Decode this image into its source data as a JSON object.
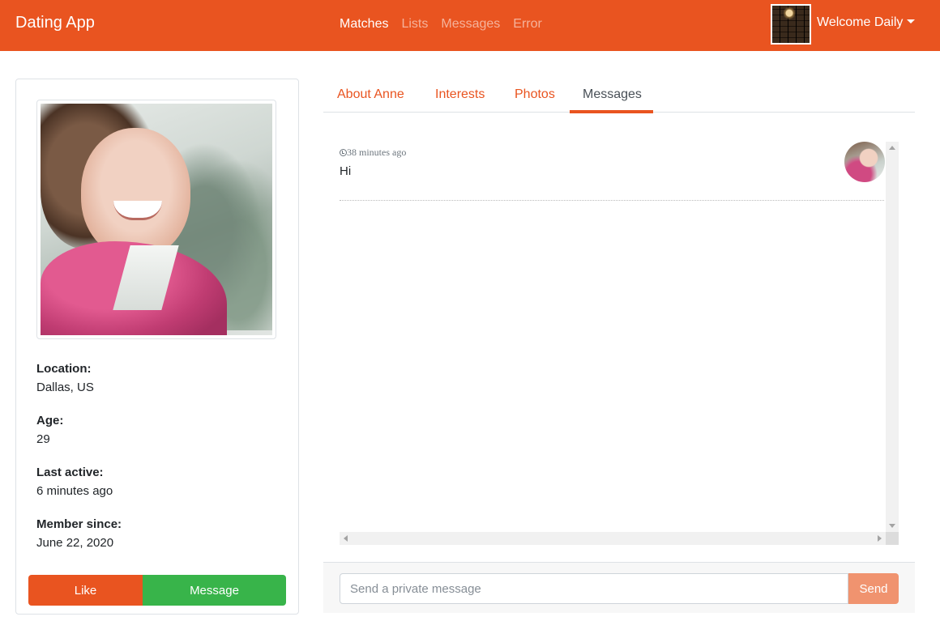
{
  "navbar": {
    "brand": "Dating App",
    "links": [
      {
        "label": "Matches",
        "active": true
      },
      {
        "label": "Lists",
        "active": false
      },
      {
        "label": "Messages",
        "active": false
      },
      {
        "label": "Error",
        "active": false
      }
    ],
    "welcome": "Welcome Daily",
    "color": "#e95420"
  },
  "profile": {
    "location_label": "Location:",
    "location": "Dallas, US",
    "age_label": "Age:",
    "age": "29",
    "last_active_label": "Last active:",
    "last_active": "6 minutes ago",
    "member_since_label": "Member since:",
    "member_since": "June 22, 2020",
    "like_label": "Like",
    "message_label": "Message"
  },
  "tabs": [
    {
      "label": "About Anne",
      "active": false
    },
    {
      "label": "Interests",
      "active": false
    },
    {
      "label": "Photos",
      "active": false
    },
    {
      "label": "Messages",
      "active": true
    }
  ],
  "messages": [
    {
      "time": "38 minutes ago",
      "text": "Hi"
    }
  ],
  "composer": {
    "placeholder": "Send a private message",
    "send_label": "Send"
  },
  "icons": {
    "clock": "clock-icon",
    "caret": "caret-down-icon"
  }
}
